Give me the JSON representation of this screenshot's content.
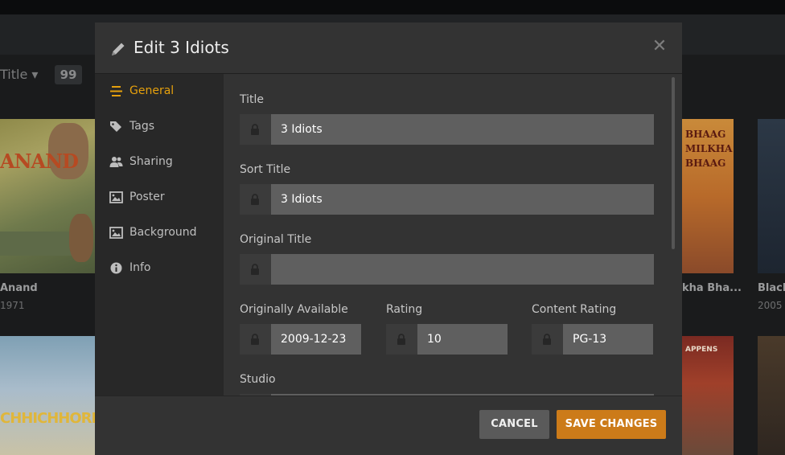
{
  "background": {
    "sort_label": "Title ▾",
    "count": "99",
    "posters": [
      {
        "title": "Anand",
        "year": "1971",
        "art_text": "ANAND"
      },
      {
        "title": "kha Bha...",
        "art_text": "BHAAG MILKHA BHAAG"
      },
      {
        "title": "Black",
        "year": "2005"
      },
      {
        "art_text": "CHHICHHORE"
      },
      {
        "art_text": "APPENS"
      }
    ]
  },
  "modal": {
    "title": "Edit 3 Idiots",
    "close_glyph": "✕",
    "sidebar": [
      {
        "label": "General",
        "icon": "general-icon",
        "active": true
      },
      {
        "label": "Tags",
        "icon": "tags-icon"
      },
      {
        "label": "Sharing",
        "icon": "sharing-icon"
      },
      {
        "label": "Poster",
        "icon": "poster-icon"
      },
      {
        "label": "Background",
        "icon": "background-icon"
      },
      {
        "label": "Info",
        "icon": "info-icon"
      }
    ],
    "fields": {
      "title": {
        "label": "Title",
        "value": "3 Idiots"
      },
      "sort_title": {
        "label": "Sort Title",
        "value": "3 Idiots"
      },
      "original_title": {
        "label": "Original Title",
        "value": ""
      },
      "originally_available": {
        "label": "Originally Available",
        "value": "2009-12-23"
      },
      "rating": {
        "label": "Rating",
        "value": "10"
      },
      "content_rating": {
        "label": "Content Rating",
        "value": "PG-13"
      },
      "studio": {
        "label": "Studio",
        "value": ""
      }
    },
    "buttons": {
      "cancel": "CANCEL",
      "save": "SAVE CHANGES"
    }
  },
  "colors": {
    "accent": "#e5a00d",
    "save_button": "#cc7b19",
    "cancel_button": "#5a5a5a"
  }
}
